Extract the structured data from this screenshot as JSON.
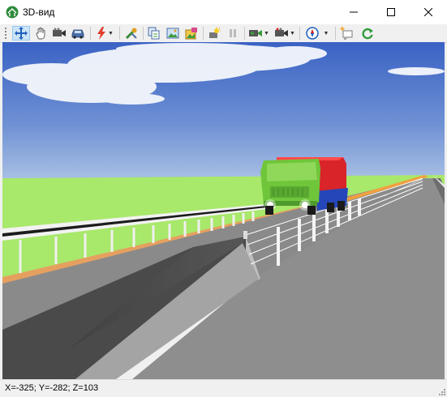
{
  "window": {
    "title": "3D-вид",
    "icon": "road-view-icon",
    "controls": [
      "minimize-icon",
      "maximize-icon",
      "close-icon"
    ]
  },
  "toolbar": {
    "buttons": [
      {
        "name": "pan-move-button",
        "icon": "move-arrows-icon",
        "active": true
      },
      {
        "name": "hand-button",
        "icon": "hand-icon"
      },
      {
        "name": "camera-button",
        "icon": "video-camera-icon"
      },
      {
        "name": "car-view-button",
        "icon": "car-icon"
      },
      {
        "name": "lightning-button",
        "icon": "lightning-icon",
        "dropdown": true
      },
      {
        "name": "tools-button",
        "icon": "tools-icon"
      },
      {
        "name": "copy-button",
        "icon": "copy-icon"
      },
      {
        "name": "image-button",
        "icon": "image-icon"
      },
      {
        "name": "image-export-button",
        "icon": "image-export-icon"
      },
      {
        "name": "light-button",
        "icon": "light-icon"
      },
      {
        "name": "pause-button",
        "icon": "pause-icon"
      },
      {
        "name": "camera-settings-button",
        "icon": "camera-settings-icon",
        "dropdown": true
      },
      {
        "name": "record-button",
        "icon": "record-icon",
        "dropdown": true
      },
      {
        "name": "compass-button",
        "icon": "compass-icon",
        "dropdown": true
      },
      {
        "name": "annotate-button",
        "icon": "annotate-icon"
      },
      {
        "name": "refresh-button",
        "icon": "refresh-icon"
      }
    ]
  },
  "status": {
    "coordinates": "X=-325; Y=-282; Z=103"
  },
  "colors": {
    "sky_top": "#3a62c4",
    "sky_bottom": "#9fb8df",
    "grass": "#a8e86a",
    "road": "#8e8e8e",
    "truck_cab": "#6fc63a",
    "truck_body": "#d9242a",
    "truck_chassis": "#2446b8",
    "refresh_green": "#2e9c3c"
  }
}
